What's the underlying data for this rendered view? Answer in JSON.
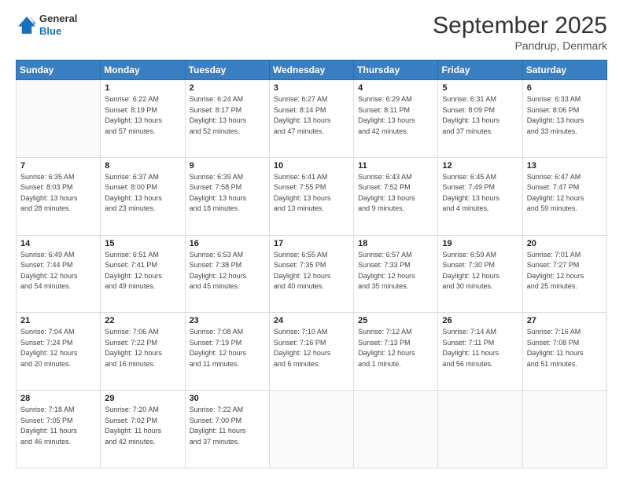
{
  "logo": {
    "general": "General",
    "blue": "Blue"
  },
  "header": {
    "title": "September 2025",
    "subtitle": "Pandrup, Denmark"
  },
  "columns": [
    "Sunday",
    "Monday",
    "Tuesday",
    "Wednesday",
    "Thursday",
    "Friday",
    "Saturday"
  ],
  "weeks": [
    [
      {
        "day": "",
        "info": ""
      },
      {
        "day": "1",
        "info": "Sunrise: 6:22 AM\nSunset: 8:19 PM\nDaylight: 13 hours\nand 57 minutes."
      },
      {
        "day": "2",
        "info": "Sunrise: 6:24 AM\nSunset: 8:17 PM\nDaylight: 13 hours\nand 52 minutes."
      },
      {
        "day": "3",
        "info": "Sunrise: 6:27 AM\nSunset: 8:14 PM\nDaylight: 13 hours\nand 47 minutes."
      },
      {
        "day": "4",
        "info": "Sunrise: 6:29 AM\nSunset: 8:11 PM\nDaylight: 13 hours\nand 42 minutes."
      },
      {
        "day": "5",
        "info": "Sunrise: 6:31 AM\nSunset: 8:09 PM\nDaylight: 13 hours\nand 37 minutes."
      },
      {
        "day": "6",
        "info": "Sunrise: 6:33 AM\nSunset: 8:06 PM\nDaylight: 13 hours\nand 33 minutes."
      }
    ],
    [
      {
        "day": "7",
        "info": "Sunrise: 6:35 AM\nSunset: 8:03 PM\nDaylight: 13 hours\nand 28 minutes."
      },
      {
        "day": "8",
        "info": "Sunrise: 6:37 AM\nSunset: 8:00 PM\nDaylight: 13 hours\nand 23 minutes."
      },
      {
        "day": "9",
        "info": "Sunrise: 6:39 AM\nSunset: 7:58 PM\nDaylight: 13 hours\nand 18 minutes."
      },
      {
        "day": "10",
        "info": "Sunrise: 6:41 AM\nSunset: 7:55 PM\nDaylight: 13 hours\nand 13 minutes."
      },
      {
        "day": "11",
        "info": "Sunrise: 6:43 AM\nSunset: 7:52 PM\nDaylight: 13 hours\nand 9 minutes."
      },
      {
        "day": "12",
        "info": "Sunrise: 6:45 AM\nSunset: 7:49 PM\nDaylight: 13 hours\nand 4 minutes."
      },
      {
        "day": "13",
        "info": "Sunrise: 6:47 AM\nSunset: 7:47 PM\nDaylight: 12 hours\nand 59 minutes."
      }
    ],
    [
      {
        "day": "14",
        "info": "Sunrise: 6:49 AM\nSunset: 7:44 PM\nDaylight: 12 hours\nand 54 minutes."
      },
      {
        "day": "15",
        "info": "Sunrise: 6:51 AM\nSunset: 7:41 PM\nDaylight: 12 hours\nand 49 minutes."
      },
      {
        "day": "16",
        "info": "Sunrise: 6:53 AM\nSunset: 7:38 PM\nDaylight: 12 hours\nand 45 minutes."
      },
      {
        "day": "17",
        "info": "Sunrise: 6:55 AM\nSunset: 7:35 PM\nDaylight: 12 hours\nand 40 minutes."
      },
      {
        "day": "18",
        "info": "Sunrise: 6:57 AM\nSunset: 7:33 PM\nDaylight: 12 hours\nand 35 minutes."
      },
      {
        "day": "19",
        "info": "Sunrise: 6:59 AM\nSunset: 7:30 PM\nDaylight: 12 hours\nand 30 minutes."
      },
      {
        "day": "20",
        "info": "Sunrise: 7:01 AM\nSunset: 7:27 PM\nDaylight: 12 hours\nand 25 minutes."
      }
    ],
    [
      {
        "day": "21",
        "info": "Sunrise: 7:04 AM\nSunset: 7:24 PM\nDaylight: 12 hours\nand 20 minutes."
      },
      {
        "day": "22",
        "info": "Sunrise: 7:06 AM\nSunset: 7:22 PM\nDaylight: 12 hours\nand 16 minutes."
      },
      {
        "day": "23",
        "info": "Sunrise: 7:08 AM\nSunset: 7:19 PM\nDaylight: 12 hours\nand 11 minutes."
      },
      {
        "day": "24",
        "info": "Sunrise: 7:10 AM\nSunset: 7:16 PM\nDaylight: 12 hours\nand 6 minutes."
      },
      {
        "day": "25",
        "info": "Sunrise: 7:12 AM\nSunset: 7:13 PM\nDaylight: 12 hours\nand 1 minute."
      },
      {
        "day": "26",
        "info": "Sunrise: 7:14 AM\nSunset: 7:11 PM\nDaylight: 11 hours\nand 56 minutes."
      },
      {
        "day": "27",
        "info": "Sunrise: 7:16 AM\nSunset: 7:08 PM\nDaylight: 11 hours\nand 51 minutes."
      }
    ],
    [
      {
        "day": "28",
        "info": "Sunrise: 7:18 AM\nSunset: 7:05 PM\nDaylight: 11 hours\nand 46 minutes."
      },
      {
        "day": "29",
        "info": "Sunrise: 7:20 AM\nSunset: 7:02 PM\nDaylight: 11 hours\nand 42 minutes."
      },
      {
        "day": "30",
        "info": "Sunrise: 7:22 AM\nSunset: 7:00 PM\nDaylight: 11 hours\nand 37 minutes."
      },
      {
        "day": "",
        "info": ""
      },
      {
        "day": "",
        "info": ""
      },
      {
        "day": "",
        "info": ""
      },
      {
        "day": "",
        "info": ""
      }
    ]
  ]
}
